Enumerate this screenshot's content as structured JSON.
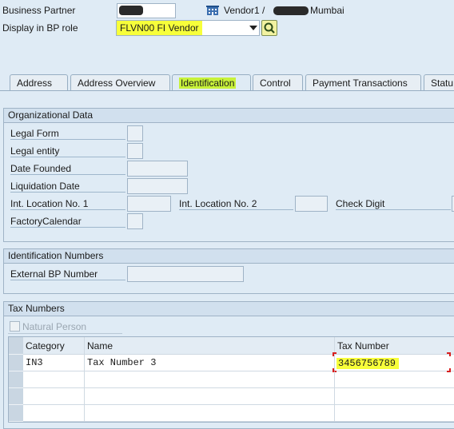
{
  "header": {
    "bp_label": "Business Partner",
    "vendor_text": "Vendor1 /",
    "vendor_city": "Mumbai",
    "role_label": "Display in BP role",
    "role_value": "FLVN00 FI Vendor"
  },
  "tabs": [
    {
      "label": "Address"
    },
    {
      "label": "Address Overview"
    },
    {
      "label": "Identification"
    },
    {
      "label": "Control"
    },
    {
      "label": "Payment Transactions"
    },
    {
      "label": "Statu"
    }
  ],
  "org_data": {
    "title": "Organizational Data",
    "legal_form": "Legal Form",
    "legal_entity": "Legal entity",
    "date_founded": "Date Founded",
    "liquidation_date": "Liquidation Date",
    "int_loc_1": "Int. Location No. 1",
    "int_loc_2": "Int. Location No. 2",
    "check_digit": "Check Digit",
    "factory_calendar": "FactoryCalendar"
  },
  "id_numbers": {
    "title": "Identification Numbers",
    "external_bp": "External BP Number"
  },
  "tax_numbers": {
    "title": "Tax Numbers",
    "natural_person": "Natural Person",
    "columns": [
      "Category",
      "Name",
      "Tax Number"
    ],
    "rows": [
      {
        "category": "IN3",
        "name": "Tax Number 3",
        "tax_number": "3456756789"
      }
    ]
  },
  "colors": {
    "background": "#dfebf5",
    "highlight_yellow": "#f7ff3a",
    "highlight_green": "#c8f23a"
  }
}
